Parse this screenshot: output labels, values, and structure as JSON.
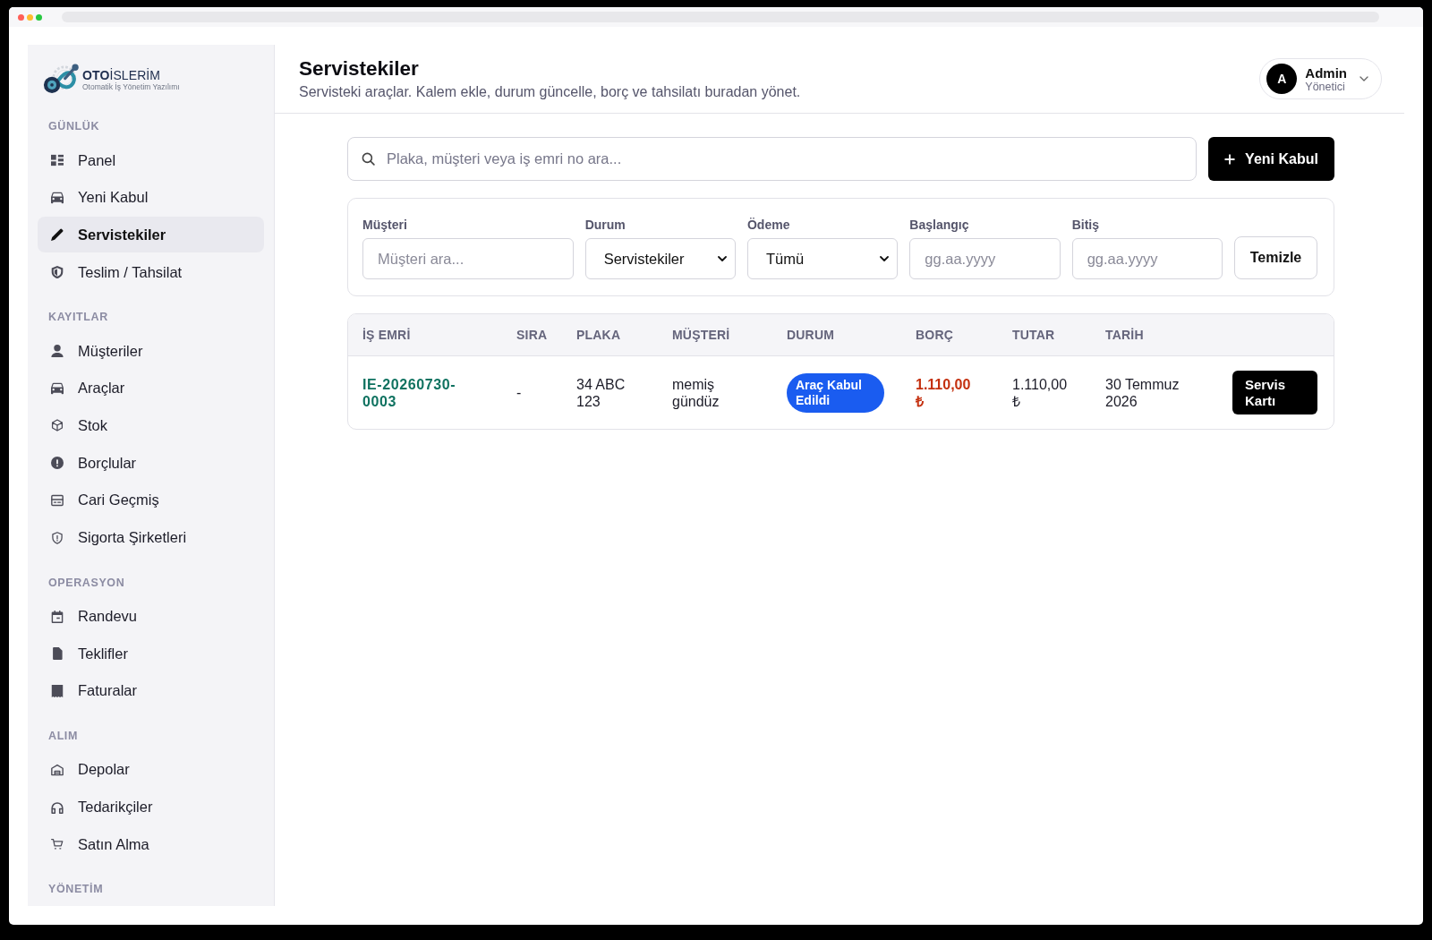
{
  "sidebar": {
    "logo": {
      "wordmark": "**OTO**İSLERİM",
      "tagline": "Otomatik İş Yönetim Yazılımı"
    },
    "sections": [
      {
        "title": "GÜNLÜK",
        "items": [
          {
            "label": "Panel",
            "selected": false
          },
          {
            "label": "Yeni Kabul",
            "selected": false
          },
          {
            "label": "Servistekiler",
            "selected": true
          },
          {
            "label": "Teslim / Tahsilat",
            "selected": false
          }
        ]
      },
      {
        "title": "KAYITLAR",
        "items": [
          {
            "label": "Müşteriler",
            "selected": false
          },
          {
            "label": "Araçlar",
            "selected": false
          },
          {
            "label": "Stok",
            "selected": false
          },
          {
            "label": "Borçlular",
            "selected": false
          },
          {
            "label": "Cari Geçmiş",
            "selected": false
          },
          {
            "label": "Sigorta Şirketleri",
            "selected": false
          }
        ]
      },
      {
        "title": "OPERASYON",
        "items": [
          {
            "label": "Randevu",
            "selected": false
          },
          {
            "label": "Teklifler",
            "selected": false
          },
          {
            "label": "Faturalar",
            "selected": false
          }
        ]
      },
      {
        "title": "ALIM",
        "items": [
          {
            "label": "Depolar",
            "selected": false
          },
          {
            "label": "Tedarikçiler",
            "selected": false
          },
          {
            "label": "Satın Alma",
            "selected": false
          }
        ]
      },
      {
        "title": "YÖNETİM"
      }
    ]
  },
  "header": {
    "title": "Servistekiler",
    "subtitle": "Servisteki araçlar. Kalem ekle, durum güncelle, borç ve tahsilatı buradan yönet.",
    "user": {
      "initial": "A",
      "name": "Admin",
      "role": "Yönetici"
    }
  },
  "search": {
    "placeholder": "Plaka, müşteri veya iş emri no ara..."
  },
  "new_button": {
    "label": "Yeni Kabul"
  },
  "filters": {
    "fields": [
      {
        "label": "Müşteri",
        "kind": "text",
        "placeholder": "Müşteri ara..."
      },
      {
        "label": "Durum",
        "kind": "select",
        "value": "Servistekiler"
      },
      {
        "label": "Ödeme",
        "kind": "select",
        "value": "Tümü"
      },
      {
        "label": "Başlangıç",
        "kind": "date",
        "placeholder": "gg.aa.yyyy"
      },
      {
        "label": "Bitiş",
        "kind": "date",
        "placeholder": "gg.aa.yyyy"
      }
    ],
    "clear_button": "Temizle"
  },
  "table": {
    "columns": [
      "İŞ EMRİ",
      "SIRA",
      "PLAKA",
      "MÜŞTERİ",
      "DURUM",
      "BORÇ",
      "TUTAR",
      "TARİH"
    ],
    "rows": [
      {
        "work_order": "IE-20260730-0003",
        "sira": "-",
        "plate": "34 ABC 123",
        "customer": "memiş gündüz",
        "status": {
          "label": "Araç Kabul Edildi",
          "color": "#1a5cf0"
        },
        "debt": {
          "amount": "1.110,00 ₺",
          "due": true
        },
        "total": "1.110,00 ₺",
        "date": "30 Temmuz 2026",
        "action": "Servis Kartı"
      }
    ]
  }
}
